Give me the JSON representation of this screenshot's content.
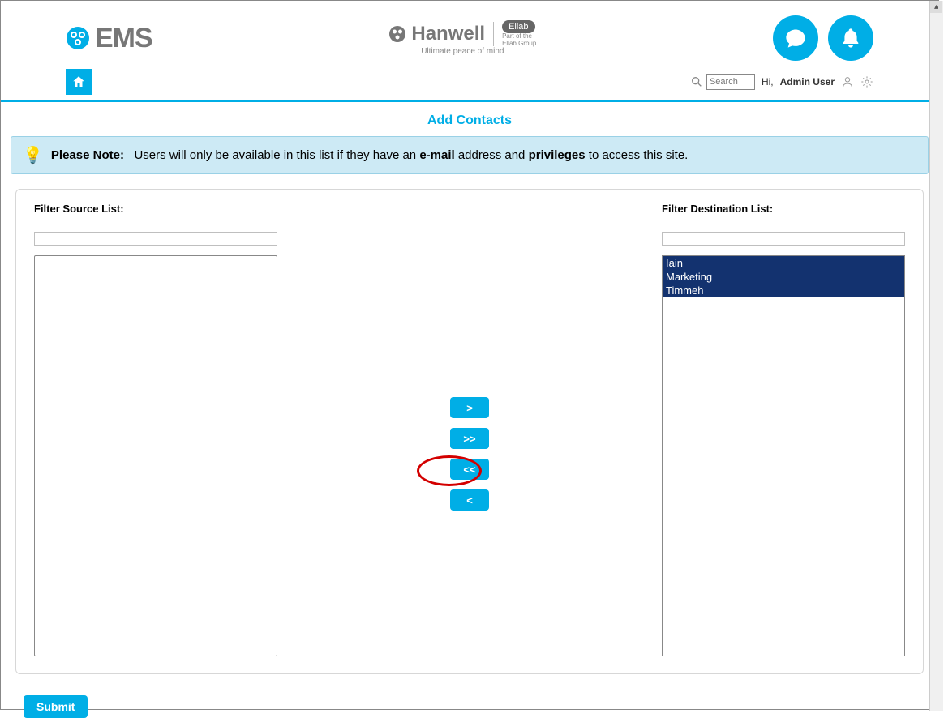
{
  "brand_left": {
    "text": "EMS"
  },
  "brand_center": {
    "name": "Hanwell",
    "tagline": "Ultimate peace of mind",
    "badge": "Ellab",
    "badge_sub1": "Part of the",
    "badge_sub2": "Ellab Group"
  },
  "search": {
    "placeholder": "Search"
  },
  "greeting": {
    "prefix": "Hi,",
    "user": "Admin User"
  },
  "page_title": "Add Contacts",
  "note": {
    "lead": "Please Note:",
    "t1": "Users will only be available in this list if they have an ",
    "b1": "e-mail",
    "t2": " address and ",
    "b2": "privileges",
    "t3": " to access this site."
  },
  "labels": {
    "source": "Filter Source List:",
    "dest": "Filter Destination List:"
  },
  "buttons": {
    "move_right": ">",
    "move_all_right": ">>",
    "move_all_left": "<<",
    "move_left": "<",
    "submit": "Submit"
  },
  "source_items": [],
  "dest_items": [
    "Iain",
    "Marketing",
    "Timmeh"
  ]
}
